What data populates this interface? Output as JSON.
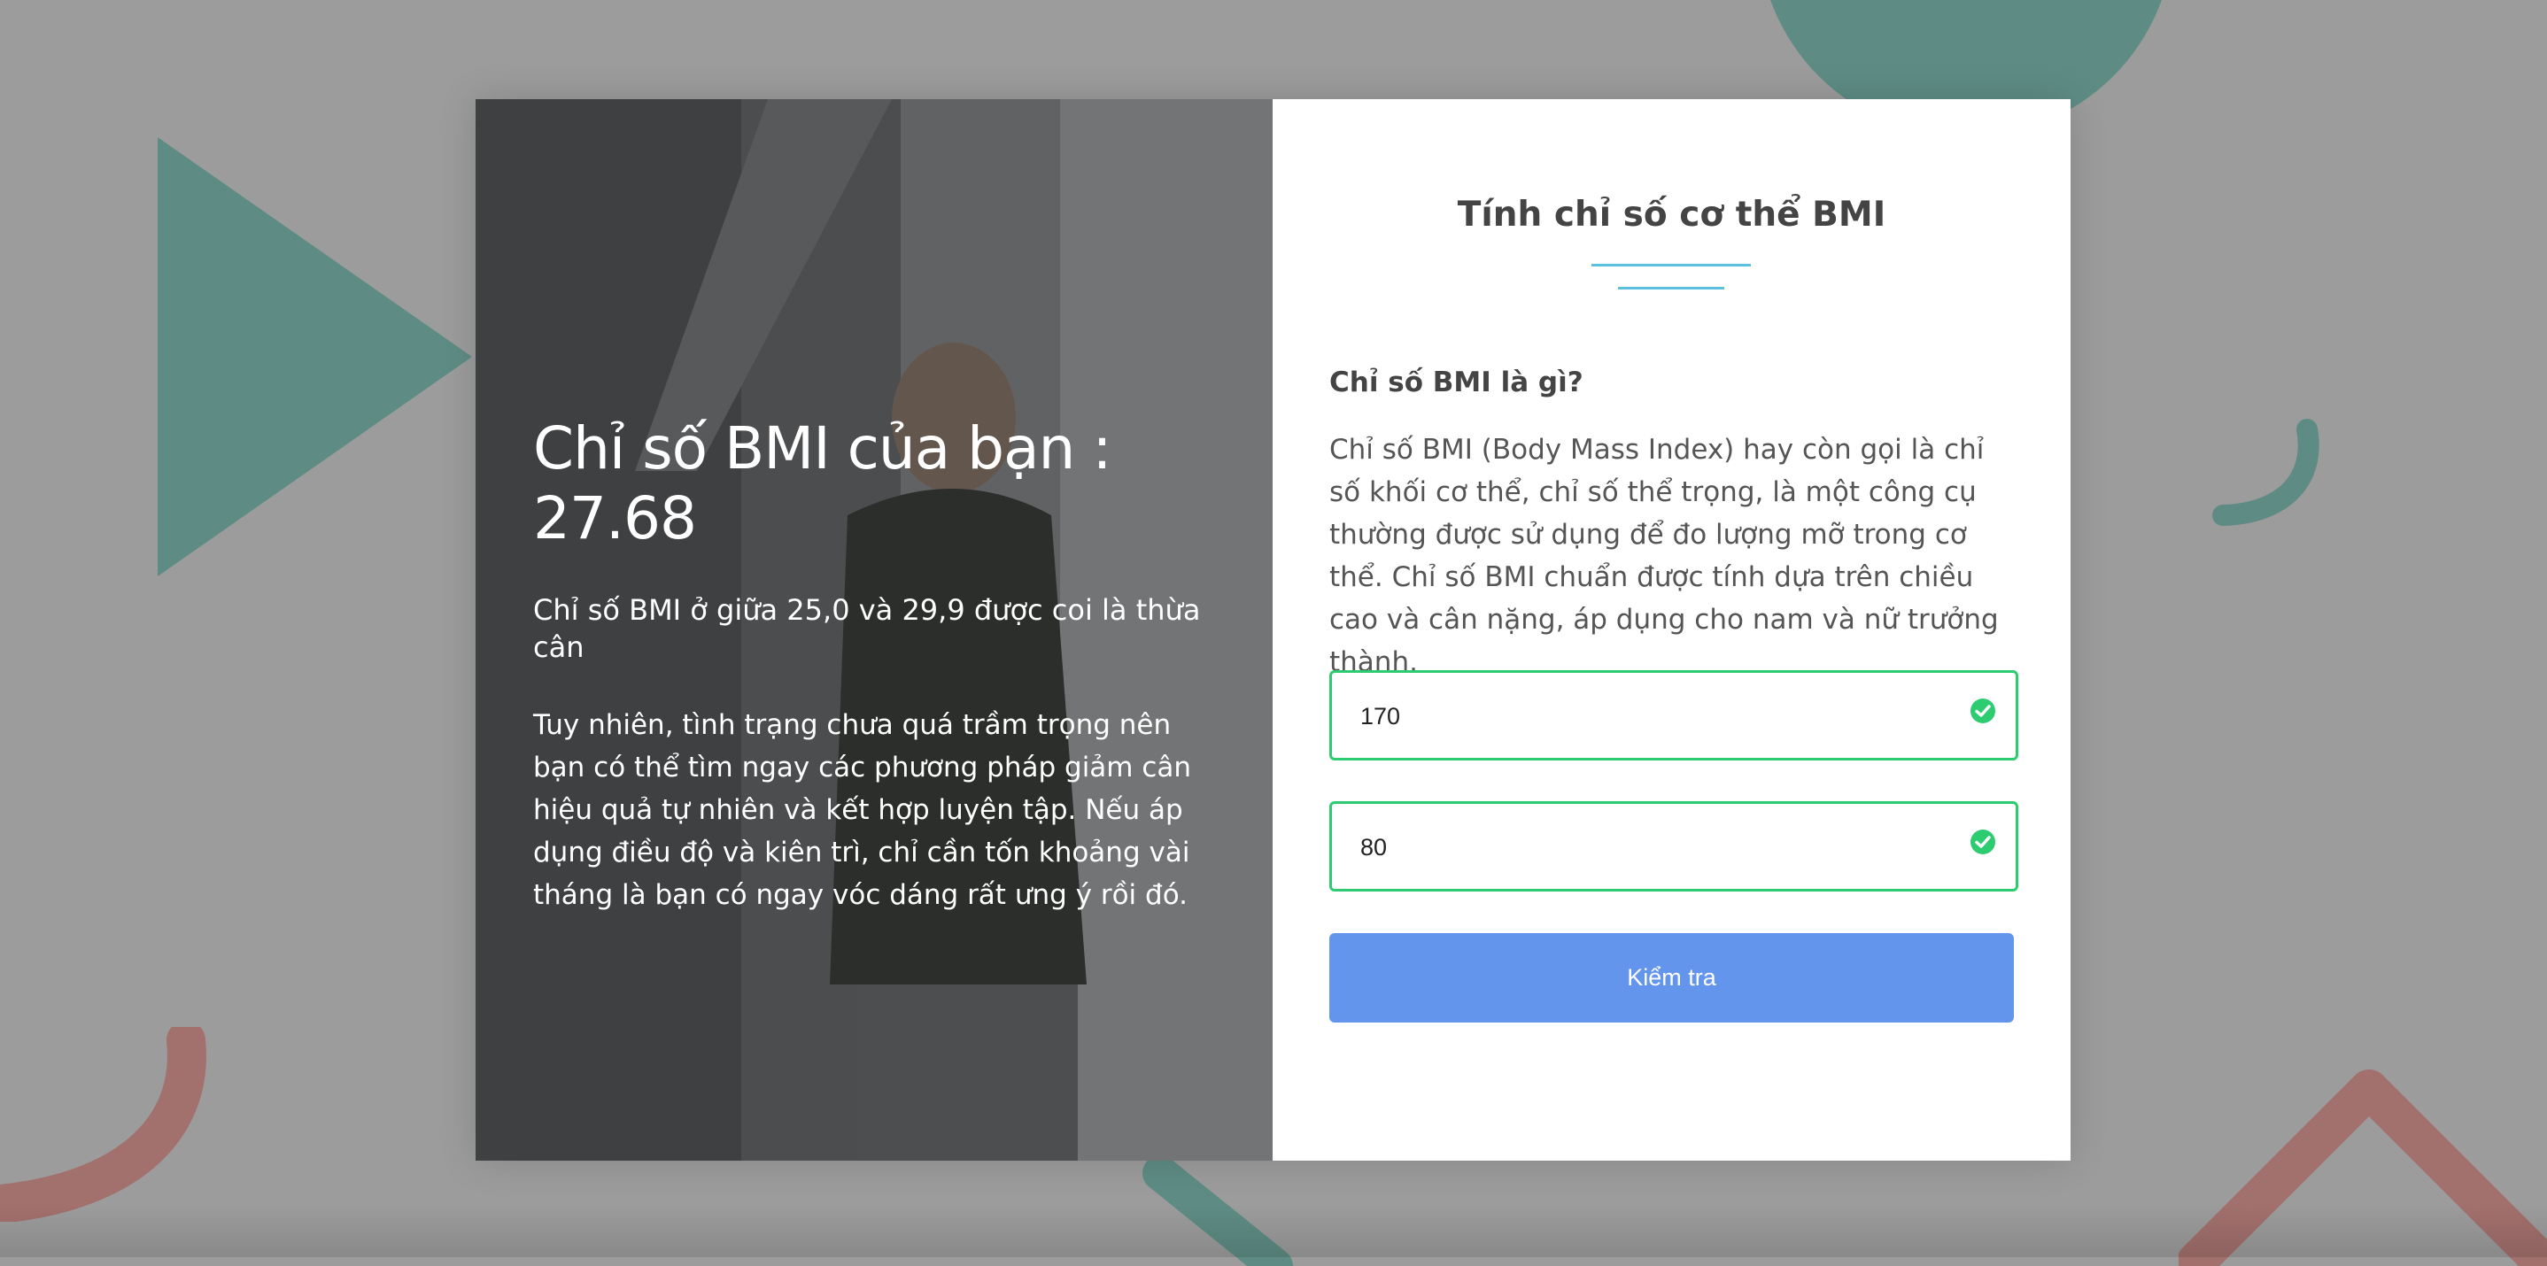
{
  "colors": {
    "background": "#9c9c9c",
    "accent_underline": "#5bc0de",
    "valid_border": "#2ecc71",
    "button": "#6495ed",
    "deco_teal": "#5e8c84",
    "deco_red": "#a2706d"
  },
  "result": {
    "title": "Chỉ số BMI của bạn : 27.68",
    "range_text": "Chỉ số BMI ở giữa 25,0 và 29,9 được coi là thừa cân",
    "advice": "Tuy nhiên, tình trạng chưa quá trầm trọng nên bạn có thể tìm ngay các phương pháp giảm cân hiệu quả tự nhiên và kết hợp luyện tập. Nếu áp dụng điều độ và kiên trì, chỉ cần tốn khoảng vài tháng là bạn có ngay vóc dáng rất ưng ý rồi đó."
  },
  "form": {
    "title": "Tính chỉ số cơ thể BMI",
    "question": "Chỉ số BMI là gì?",
    "description": "Chỉ số BMI (Body Mass Index) hay còn gọi là chỉ số khối cơ thể, chỉ số thể trọng, là một công cụ thường được sử dụng để đo lượng mỡ trong cơ thể. Chỉ số BMI chuẩn được tính dựa trên chiều cao và cân nặng, áp dụng cho nam và nữ trưởng thành.",
    "height_value": "170",
    "weight_value": "80",
    "submit_label": "Kiểm tra",
    "valid_icon": "check-circle-icon"
  }
}
